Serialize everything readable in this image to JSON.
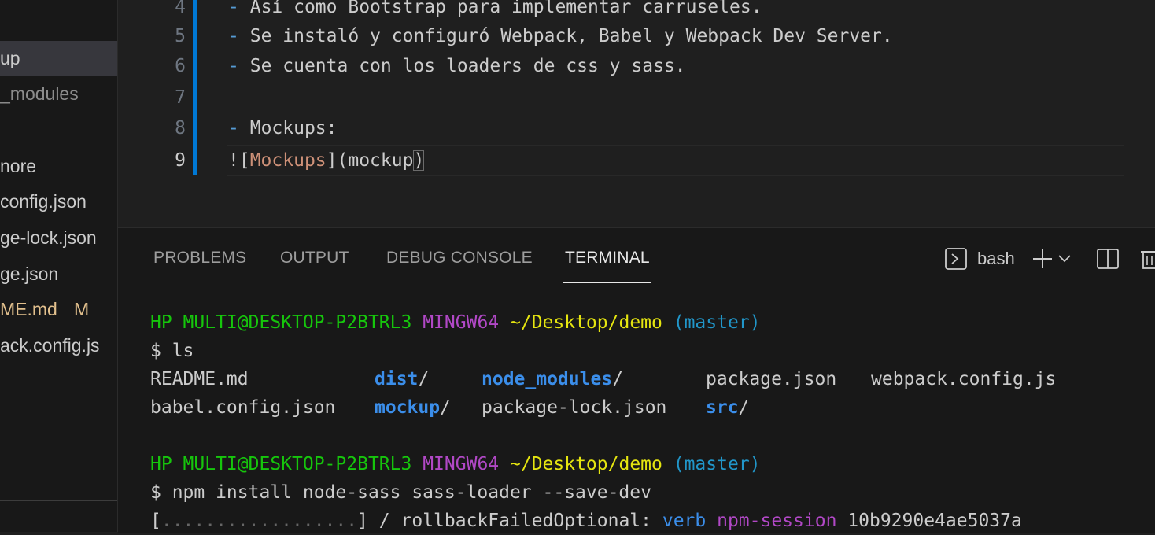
{
  "sidebar": {
    "items": [
      {
        "label": "up",
        "state": "selected"
      },
      {
        "label": "_modules",
        "state": "dim"
      },
      {
        "label": "nore",
        "state": "normal"
      },
      {
        "label": "config.json",
        "state": "normal"
      },
      {
        "label": "ge-lock.json",
        "state": "normal"
      },
      {
        "label": "ge.json",
        "state": "normal"
      },
      {
        "label": "ME.md",
        "state": "modified",
        "badge": "M"
      },
      {
        "label": "ack.config.js",
        "state": "normal"
      }
    ]
  },
  "editor": {
    "lines": [
      {
        "num": "4",
        "text": "Así como Bootstrap para implementar carruseles."
      },
      {
        "num": "5",
        "text": "Se instaló y configuró Webpack, Babel y Webpack Dev Server."
      },
      {
        "num": "6",
        "text": "Se cuenta con los loaders de css y sass."
      },
      {
        "num": "7",
        "text": ""
      },
      {
        "num": "8",
        "text": "Mockups:"
      },
      {
        "num": "9",
        "link_bang": "![",
        "link_text": "Mockups",
        "link_mid": "](",
        "link_target": "mockup",
        "link_end": ")"
      }
    ],
    "bullet": "-"
  },
  "panel": {
    "tabs": [
      "PROBLEMS",
      "OUTPUT",
      "DEBUG CONSOLE",
      "TERMINAL"
    ],
    "active_tab": "TERMINAL",
    "shell_label": "bash",
    "icons": [
      "terminal-icon",
      "plus-icon",
      "chevron-down-icon",
      "split-icon",
      "trash-icon"
    ]
  },
  "terminal": {
    "prompt1": {
      "user": "HP MULTI@DESKTOP-P2BTRL3",
      "sys": "MINGW64",
      "path": "~/Desktop/demo",
      "branch": "(master)"
    },
    "cmd1": "$ ls",
    "ls_row1": [
      "README.md",
      "dist",
      "node_modules",
      "package.json",
      "webpack.config.js"
    ],
    "ls_row2": [
      "babel.config.json",
      "mockup",
      "package-lock.json",
      "src"
    ],
    "slash": "/",
    "prompt2": {
      "user": "HP MULTI@DESKTOP-P2BTRL3",
      "sys": "MINGW64",
      "path": "~/Desktop/demo",
      "branch": "(master)"
    },
    "cmd2": "$ npm install node-sass sass-loader --save-dev",
    "progress": {
      "open": "[",
      "dots": "..................",
      "close": "] / rollbackFailedOptional: ",
      "verb": "verb",
      "session": "npm-session",
      "id": "10b9290e4ae5037a"
    }
  },
  "colors": {
    "accent": "#0078d4",
    "prompt_green": "#16c60c",
    "prompt_magenta": "#b148c6",
    "prompt_yellow": "#e5e510",
    "branch_cyan": "#2196c9",
    "dir_blue": "#3b8eea",
    "link_orange": "#ce9178"
  }
}
